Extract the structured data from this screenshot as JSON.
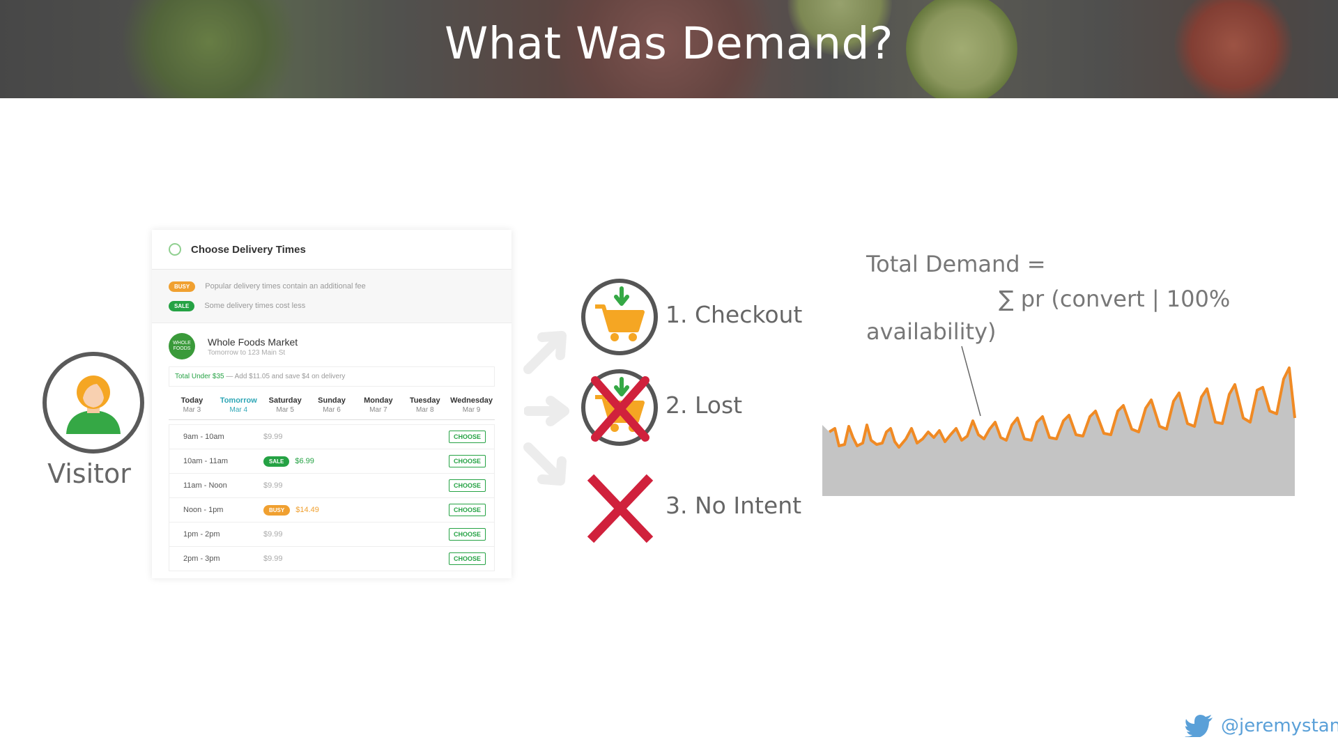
{
  "slide": {
    "title": "What Was Demand?"
  },
  "visitor": {
    "label": "Visitor"
  },
  "delivery_card": {
    "title": "Choose Delivery Times",
    "legend": [
      {
        "tag": "BUSY",
        "text": "Popular delivery times contain an additional fee"
      },
      {
        "tag": "SALE",
        "text": "Some delivery times cost less"
      }
    ],
    "store": {
      "logo_text": "WHOLE FOODS",
      "name": "Whole Foods Market",
      "subtitle": "Tomorrow  to 123 Main St"
    },
    "total": {
      "highlight": "Total Under $35",
      "text": " — Add $11.05 and save $4 on delivery"
    },
    "days": [
      {
        "name": "Today",
        "date": "Mar 3"
      },
      {
        "name": "Tomorrow",
        "date": "Mar 4"
      },
      {
        "name": "Saturday",
        "date": "Mar 5"
      },
      {
        "name": "Sunday",
        "date": "Mar 6"
      },
      {
        "name": "Monday",
        "date": "Mar 7"
      },
      {
        "name": "Tuesday",
        "date": "Mar 8"
      },
      {
        "name": "Wednesday",
        "date": "Mar 9"
      }
    ],
    "selected_day": "Tomorrow",
    "slots": [
      {
        "time": "9am - 10am",
        "tag": "",
        "price": "$9.99",
        "action": "CHOOSE"
      },
      {
        "time": "10am - 11am",
        "tag": "SALE",
        "price": "$6.99",
        "action": "CHOOSE"
      },
      {
        "time": "11am - Noon",
        "tag": "",
        "price": "$9.99",
        "action": "CHOOSE"
      },
      {
        "time": "Noon - 1pm",
        "tag": "BUSY",
        "price": "$14.49",
        "action": "CHOOSE"
      },
      {
        "time": "1pm - 2pm",
        "tag": "",
        "price": "$9.99",
        "action": "CHOOSE"
      },
      {
        "time": "2pm - 3pm",
        "tag": "",
        "price": "$9.99",
        "action": "CHOOSE"
      }
    ]
  },
  "outcomes": [
    {
      "label": "1. Checkout",
      "icon": "cart-icon"
    },
    {
      "label": "2. Lost",
      "icon": "crossed-cart-icon"
    },
    {
      "label": "3. No Intent",
      "icon": "x-icon"
    }
  ],
  "formula": {
    "line1": "Total  Demand  =",
    "line2": "∑ pr (convert  |  100%",
    "line3": "availability)"
  },
  "demand_chart": {
    "colors": {
      "total_demand": "#c4c4c4",
      "converted": "#f08a24"
    }
  },
  "footer": {
    "handle": "@jeremystan"
  },
  "colors": {
    "accent_orange": "#f5a623",
    "cart_green": "#35a845",
    "x_red": "#d0213c",
    "twitter_blue": "#5aa0d8"
  }
}
